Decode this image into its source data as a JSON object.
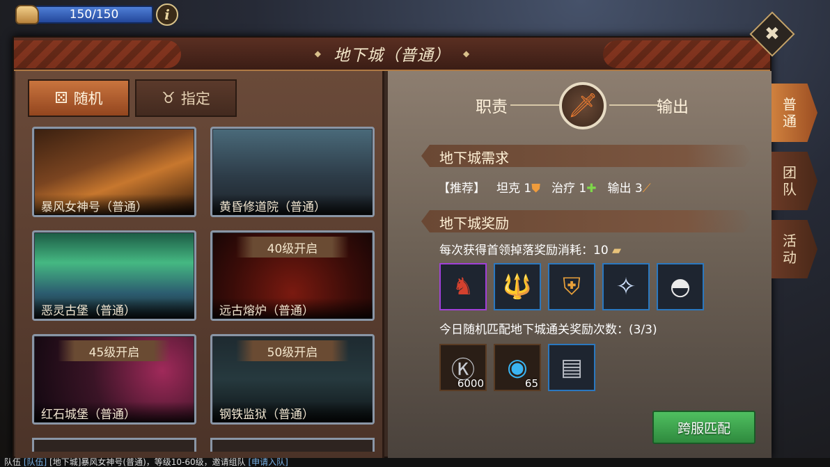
{
  "topbar": {
    "energy": "150/150",
    "info_glyph": "i"
  },
  "panel": {
    "title": "地下城（普通）",
    "close_glyph": "✖"
  },
  "mode_tabs": [
    {
      "label": "随机",
      "icon": "dice-icon",
      "active": true
    },
    {
      "label": "指定",
      "icon": "bull-skull-icon",
      "active": false
    }
  ],
  "dungeons": [
    {
      "name": "暴风女神号（普通）",
      "lock": ""
    },
    {
      "name": "黄昏修道院（普通）",
      "lock": ""
    },
    {
      "name": "恶灵古堡（普通）",
      "lock": ""
    },
    {
      "name": "远古熔炉（普通）",
      "lock": "40级开启"
    },
    {
      "name": "红石城堡（普通）",
      "lock": "45级开启"
    },
    {
      "name": "钢铁监狱（普通）",
      "lock": "50级开启"
    }
  ],
  "role": {
    "left_label": "职责",
    "right_label": "输出",
    "icon": "sword-icon"
  },
  "requirements": {
    "heading": "地下城需求",
    "recommend": "【推荐】",
    "tank": "坦克 1",
    "heal": "治疗 1",
    "dps": "输出 3"
  },
  "rewards": {
    "heading": "地下城奖励",
    "cost_text": "每次获得首领掉落奖励消耗：10",
    "items": [
      {
        "icon": "horse-mount-icon",
        "rarity": "epic"
      },
      {
        "icon": "trident-icon",
        "rarity": "rare"
      },
      {
        "icon": "armor-icon",
        "rarity": "rare"
      },
      {
        "icon": "wisp-icon",
        "rarity": "rare"
      },
      {
        "icon": "powder-bowl-icon",
        "rarity": "rare"
      }
    ],
    "daily_text": "今日随机匹配地下城通关奖励次数：(3/3)",
    "daily_items": [
      {
        "icon": "silver-coin-icon",
        "qty": "6000"
      },
      {
        "icon": "blue-orb-icon",
        "qty": "65"
      },
      {
        "icon": "cloth-icon",
        "qty": ""
      }
    ]
  },
  "match_button": "跨服匹配",
  "side_tabs": [
    {
      "label": "普通",
      "active": true
    },
    {
      "label": "团队",
      "active": false
    },
    {
      "label": "活动",
      "active": false
    }
  ],
  "chat": {
    "channel": "队伍",
    "tag": "[队伍]",
    "content": "[地下城]暴风女神号(普通)，等级10-60级，邀请组队",
    "link": "[申请入队]"
  }
}
